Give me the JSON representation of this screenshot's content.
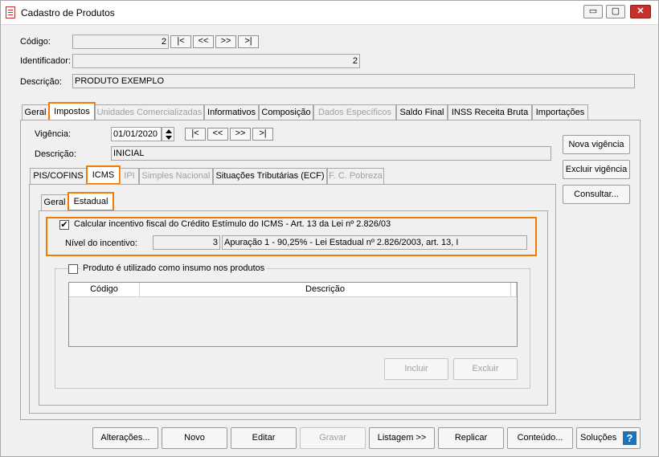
{
  "window": {
    "title": "Cadastro de Produtos",
    "min": "▭",
    "max": "▢",
    "close": "✕"
  },
  "header": {
    "codigo_label": "Código:",
    "codigo_value": "2",
    "identificador_label": "Identificador:",
    "identificador_value": "2",
    "descricao_label": "Descrição:",
    "descricao_value": "PRODUTO EXEMPLO",
    "nav": [
      "|<",
      "<<",
      ">>",
      ">|"
    ]
  },
  "main_tabs": [
    "Geral",
    "Impostos",
    "Unidades Comercializadas",
    "Informativos",
    "Composição",
    "Dados Específicos",
    "Saldo Final",
    "INSS Receita Bruta",
    "Importações"
  ],
  "impostos": {
    "vigencia_label": "Vigência:",
    "vigencia_value": "01/01/2020",
    "descricao_label": "Descrição:",
    "descricao_value": "INICIAL",
    "nova_vigencia": "Nova vigência",
    "excluir_vigencia": "Excluir vigência",
    "consultar": "Consultar...",
    "sub_tabs": [
      "PIS/COFINS",
      "ICMS",
      "IPI",
      "Simples Nacional",
      "Situações Tributárias (ECF)",
      "F. C. Pobreza"
    ]
  },
  "icms": {
    "tabs": [
      "Geral",
      "Estadual"
    ],
    "incentivo_label": "Calcular incentivo fiscal do Crédito Estímulo do ICMS - Art. 13 da Lei nº 2.826/03",
    "incentivo_checked": "✔",
    "nivel_label": "Nível do incentivo:",
    "nivel_value": "3",
    "nivel_desc": "Apuração 1 - 90,25% - Lei Estadual nº 2.826/2003, art. 13, I",
    "insumo_label": "Produto é utilizado como insumo nos produtos",
    "grid_headers": [
      "Código",
      "Descrição"
    ],
    "incluir": "Incluir",
    "excluir": "Excluir"
  },
  "footer": {
    "buttons": [
      "Alterações...",
      "Novo",
      "Editar",
      "Gravar",
      "Listagem >>",
      "Replicar",
      "Conteúdo...",
      "Soluções"
    ],
    "help": "?"
  },
  "colors": {
    "highlight": "#f07c00",
    "help": "#1e73be",
    "close": "#c7312b"
  }
}
